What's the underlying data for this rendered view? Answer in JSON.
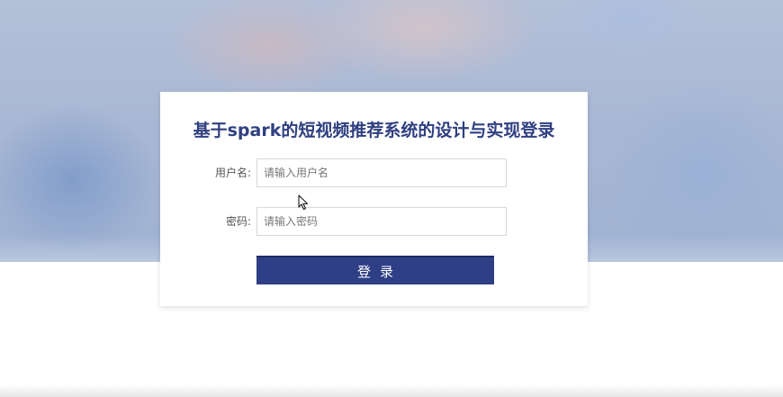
{
  "login": {
    "title": "基于spark的短视频推荐系统的设计与实现登录",
    "username_label": "用户名:",
    "username_placeholder": "请输入用户名",
    "password_label": "密码:",
    "password_placeholder": "请输入密码",
    "submit_label": "登录"
  },
  "colors": {
    "accent": "#2f3f86",
    "title": "#2f3f80"
  },
  "icons": {
    "cursor": "mouse-pointer-icon"
  }
}
